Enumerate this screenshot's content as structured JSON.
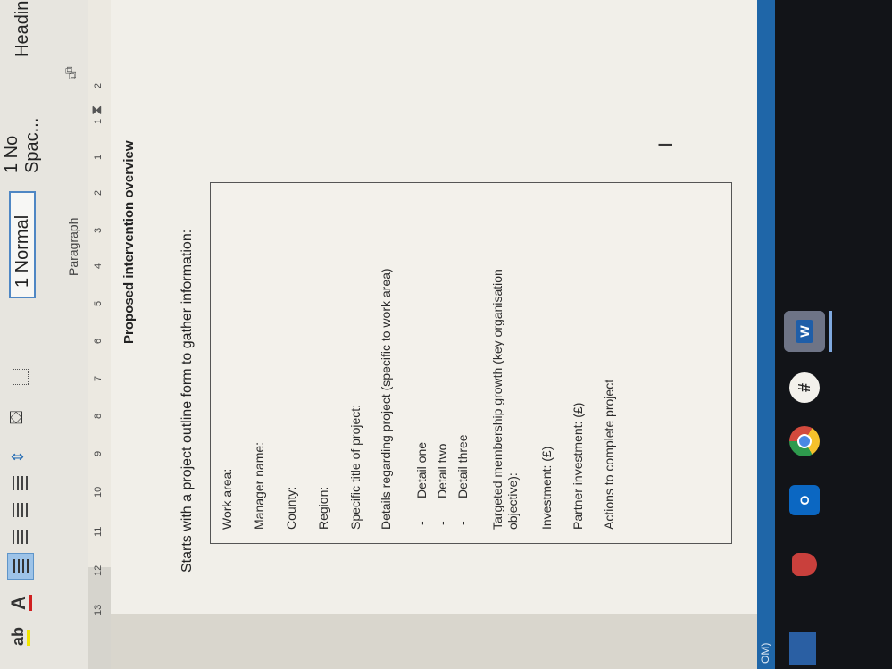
{
  "ribbon": {
    "group_label": "Paragraph",
    "styles": [
      "1 Normal",
      "1 No Spac...",
      "Heading"
    ]
  },
  "ruler": {
    "marks": [
      "2",
      "1",
      "1",
      "2",
      "3",
      "4",
      "5",
      "6",
      "7",
      "8",
      "9",
      "10",
      "11",
      "12",
      "13"
    ]
  },
  "document": {
    "title": "Proposed intervention overview",
    "intro": "Starts with a project outline form to gather information:",
    "form": {
      "work_area": "Work area:",
      "manager_name": "Manager name:",
      "county": "County:",
      "region": "Region:",
      "specific_title": "Specific title of project:",
      "details_heading": "Details regarding project (specific to work area)",
      "detail_items": [
        "Detail one",
        "Detail two",
        "Detail three"
      ],
      "targeted_line1": "Targeted membership growth (key organisation",
      "targeted_line2": "objective):",
      "investment": "Investment: (£)",
      "partner_investment": "Partner investment: (£)",
      "actions": "Actions to complete project"
    }
  },
  "statusbar": {
    "label": "OM)"
  },
  "taskbar": {
    "icons": [
      "mail-icon",
      "security-icon",
      "outlook-icon",
      "chrome-icon",
      "slack-icon",
      "word-icon"
    ],
    "outlook_text": "O",
    "slack_text": "#",
    "word_text": "W"
  },
  "colors": {
    "accent": "#1f66a8",
    "ribbon": "#e7e5df",
    "page": "#f1efe9",
    "taskbar": "#121418"
  }
}
